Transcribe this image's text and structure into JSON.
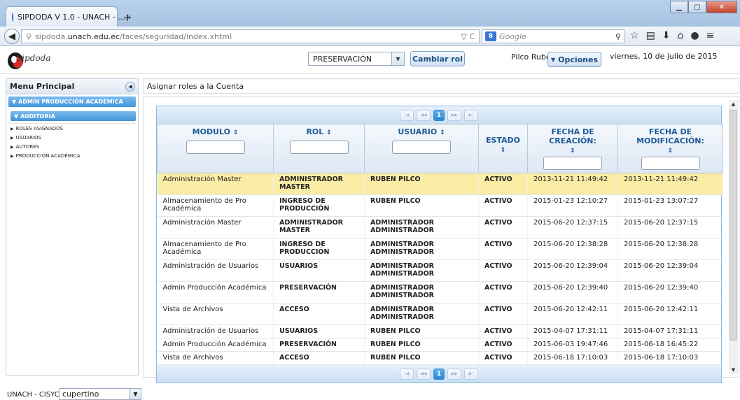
{
  "browser": {
    "tab_title": "SIPDODA V 1.0 - UNACH - ...",
    "tab_close": "×",
    "new_tab": "+",
    "url_prefix": "sipdoda.",
    "url_host": "unach.edu.ec",
    "url_path": "/faces/seguridad/index.xhtml",
    "url_right": "▽ C",
    "search_engine": "8",
    "search_placeholder": "Google"
  },
  "header": {
    "logo_text": "Sipdoda",
    "role_value": "PRESERVACIÓN",
    "cambiar_rol_label": "Cambiar rol",
    "user_name": "Pilco Rubén",
    "opciones_label": "Opciones",
    "date_text": "viernes, 10 de julio de 2015"
  },
  "sidebar": {
    "title": "Menu Principal",
    "section": "ADMIN PRODUCCIÓN ACADEMICA",
    "subsection": "AUDITORIA",
    "items": [
      {
        "label": "ROLES ASIGNADOS"
      },
      {
        "label": "USUARIOS"
      },
      {
        "label": "AUTORES"
      },
      {
        "label": "PRODUCCIÓN ACADÉMICA"
      }
    ]
  },
  "content": {
    "title": "Asignar roles a la Cuenta"
  },
  "table": {
    "page": "1",
    "columns": [
      {
        "label": "MODULO",
        "sort": "⇕"
      },
      {
        "label": "ROL",
        "sort": "⇕"
      },
      {
        "label": "USUARIO",
        "sort": "⇕"
      },
      {
        "label": "ESTADO",
        "sort": "⇕"
      },
      {
        "label": "FECHA DE CREACIÓN:",
        "sort": "⇕"
      },
      {
        "label": "FECHA DE MODIFICACIÓN:",
        "sort": "⇕"
      }
    ],
    "rows": [
      {
        "modulo": "Administración Master",
        "rol": "ADMINISTRADOR MASTER",
        "usuario": "RUBEN PILCO",
        "estado": "ACTIVO",
        "creacion": "2013-11-21 11:49:42",
        "modificacion": "2013-11-21 11:49:42"
      },
      {
        "modulo": "Almacenamiento de Pro Académica",
        "rol": "INGRESO DE PRODUCCIÓN",
        "usuario": "RUBEN PILCO",
        "estado": "ACTIVO",
        "creacion": "2015-01-23 12:10:27",
        "modificacion": "2015-01-23 13:07:27"
      },
      {
        "modulo": "Administración Master",
        "rol": "ADMINISTRADOR MASTER",
        "usuario": "ADMINISTRADOR ADMINISTRADOR",
        "estado": "ACTIVO",
        "creacion": "2015-06-20 12:37:15",
        "modificacion": "2015-06-20 12:37:15"
      },
      {
        "modulo": "Almacenamiento de Pro Académica",
        "rol": "INGRESO DE PRODUCCIÓN",
        "usuario": "ADMINISTRADOR ADMINISTRADOR",
        "estado": "ACTIVO",
        "creacion": "2015-06-20 12:38:28",
        "modificacion": "2015-06-20 12:38:28"
      },
      {
        "modulo": "Administración de Usuarios",
        "rol": "USUARIOS",
        "usuario": "ADMINISTRADOR ADMINISTRADOR",
        "estado": "ACTIVO",
        "creacion": "2015-06-20 12:39:04",
        "modificacion": "2015-06-20 12:39:04"
      },
      {
        "modulo": "Admin Producción Académica",
        "rol": "PRESERVACIÓN",
        "usuario": "ADMINISTRADOR ADMINISTRADOR",
        "estado": "ACTIVO",
        "creacion": "2015-06-20 12:39:40",
        "modificacion": "2015-06-20 12:39:40"
      },
      {
        "modulo": "Vista de Archivos",
        "rol": "ACCESO",
        "usuario": "ADMINISTRADOR ADMINISTRADOR",
        "estado": "ACTIVO",
        "creacion": "2015-06-20 12:42:11",
        "modificacion": "2015-06-20 12:42:11"
      },
      {
        "modulo": "Administración de Usuarios",
        "rol": "USUARIOS",
        "usuario": "RUBEN PILCO",
        "estado": "ACTIVO",
        "creacion": "2015-04-07 17:31:11",
        "modificacion": "2015-04-07 17:31:11"
      },
      {
        "modulo": "Admin Producción Académica",
        "rol": "PRESERVACIÓN",
        "usuario": "RUBEN PILCO",
        "estado": "ACTIVO",
        "creacion": "2015-06-03 19:47:46",
        "modificacion": "2015-06-18 16:45:22"
      },
      {
        "modulo": "Vista de Archivos",
        "rol": "ACCESO",
        "usuario": "RUBEN PILCO",
        "estado": "ACTIVO",
        "creacion": "2015-06-18 17:10:03",
        "modificacion": "2015-06-18 17:10:03"
      }
    ]
  },
  "footer": {
    "label": "UNACH - CISYC",
    "theme_value": "cupertino"
  },
  "colors": {
    "accent": "#3f95da",
    "selected_row": "#fbeca6",
    "header_text": "#1f5a96"
  }
}
